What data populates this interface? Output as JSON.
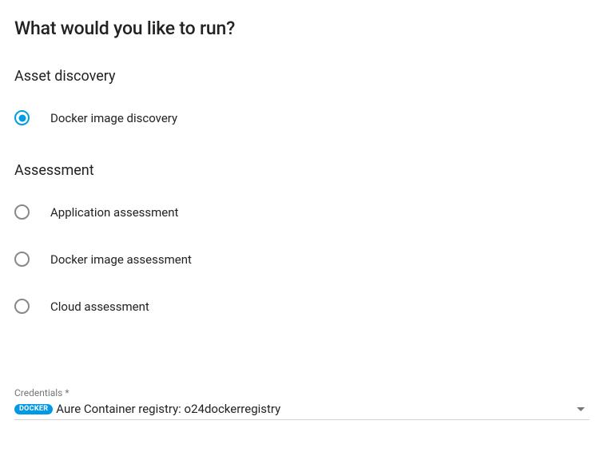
{
  "page": {
    "title": "What would you like to run?"
  },
  "sections": {
    "discovery": {
      "heading": "Asset discovery",
      "options": [
        {
          "label": "Docker image discovery",
          "selected": true
        }
      ]
    },
    "assessment": {
      "heading": "Assessment",
      "options": [
        {
          "label": "Application assessment",
          "selected": false
        },
        {
          "label": "Docker image assessment",
          "selected": false
        },
        {
          "label": "Cloud assessment",
          "selected": false
        }
      ]
    }
  },
  "credentials": {
    "label": "Credentials *",
    "badge_text": "DOCKER",
    "selected_value": "Aure Container registry: o24dockerregistry"
  }
}
